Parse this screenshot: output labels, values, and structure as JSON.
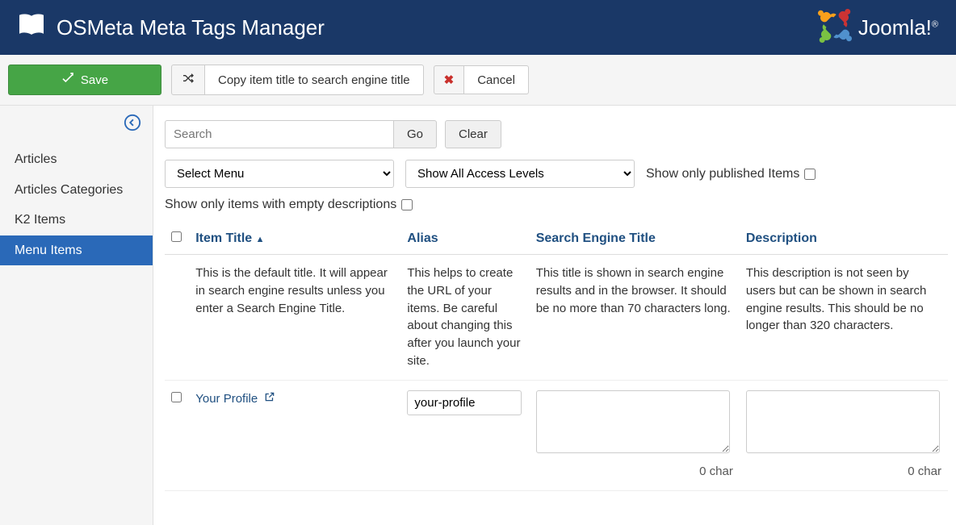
{
  "header": {
    "title": "OSMeta Meta Tags Manager",
    "brand": "Joomla!"
  },
  "toolbar": {
    "save": "Save",
    "copy_title": "Copy item title to search engine title",
    "cancel": "Cancel"
  },
  "sidebar": {
    "items": [
      {
        "label": "Articles",
        "active": false
      },
      {
        "label": "Articles Categories",
        "active": false
      },
      {
        "label": "K2 Items",
        "active": false
      },
      {
        "label": "Menu Items",
        "active": true
      }
    ]
  },
  "filters": {
    "search_placeholder": "Search",
    "go": "Go",
    "clear": "Clear",
    "select_menu": "Select Menu",
    "select_access": "Show All Access Levels",
    "published_only": "Show only published Items",
    "empty_desc_only": "Show only items with empty descriptions"
  },
  "table": {
    "headers": {
      "item_title": "Item Title",
      "alias": "Alias",
      "search_engine_title": "Search Engine Title",
      "description": "Description"
    },
    "help_row": {
      "item_title": "This is the default title. It will appear in search engine results unless you enter a Search Engine Title.",
      "alias": "This helps to create the URL of your items. Be careful about changing this after you launch your site.",
      "search_engine_title": "This title is shown in search engine results and in the browser. It should be no more than 70 characters long.",
      "description": "This description is not seen by users but can be shown in search engine results. This should be no longer than 320 characters."
    },
    "rows": [
      {
        "title": "Your Profile",
        "alias": "your-profile",
        "set_value": "",
        "set_chars": "0 char",
        "desc_value": "",
        "desc_chars": "0 char"
      }
    ]
  }
}
